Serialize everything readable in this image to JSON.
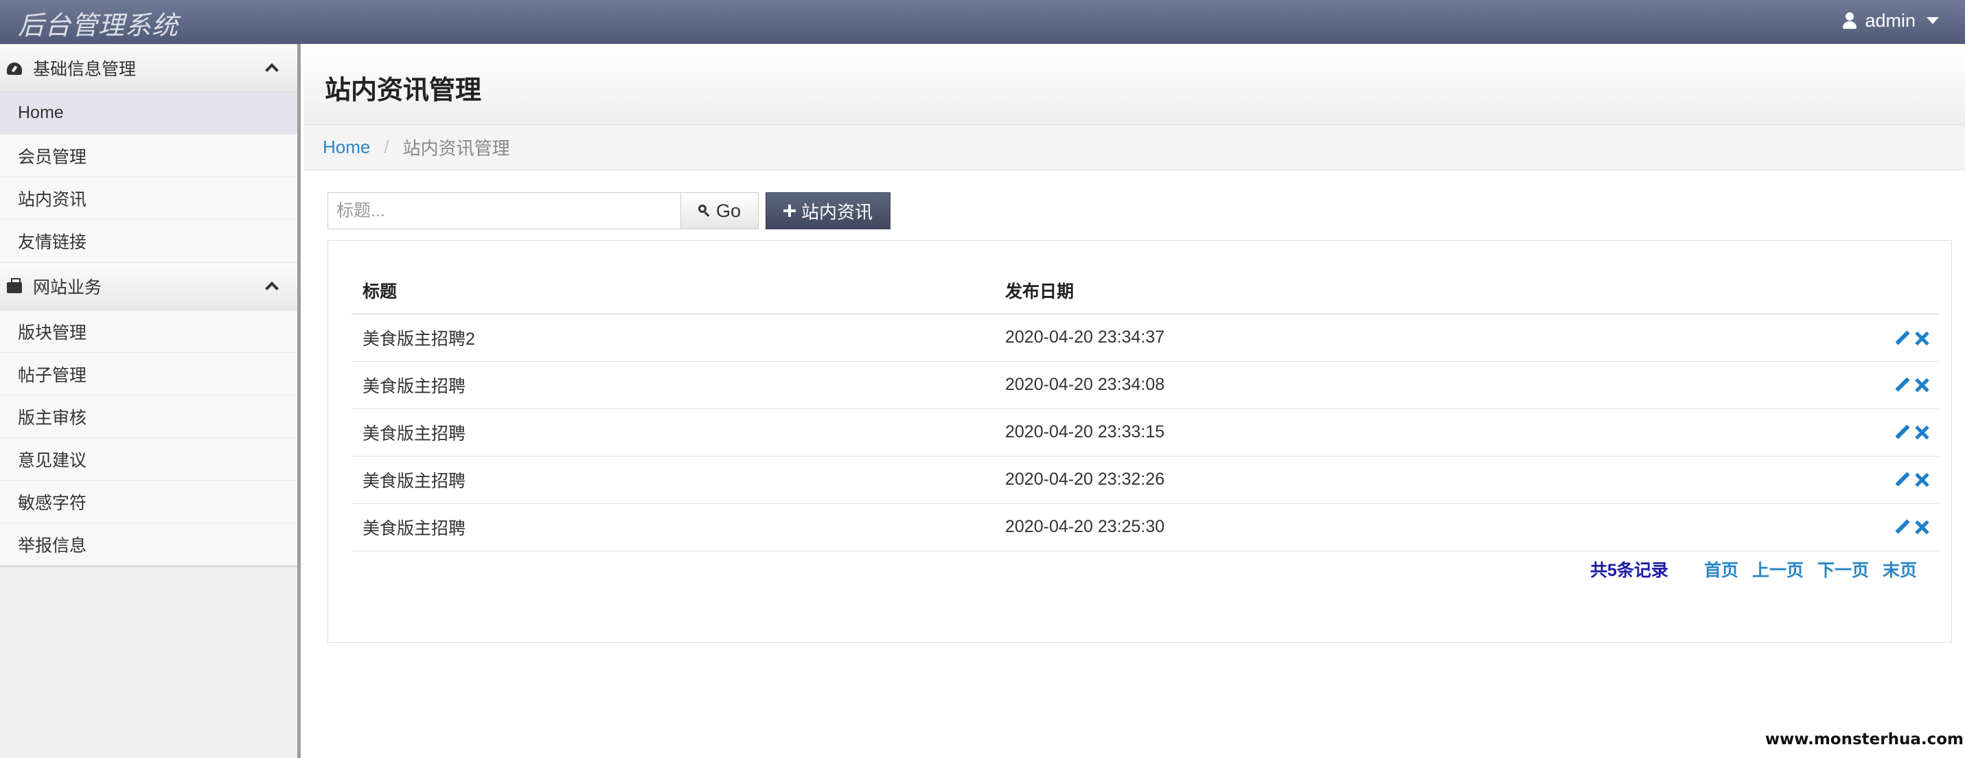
{
  "app": {
    "brand": "后台管理系统",
    "user": "admin"
  },
  "sidebar": {
    "groups": [
      {
        "label": "基础信息管理",
        "icon": "dashboard-icon",
        "items": [
          {
            "label": "Home",
            "active": true
          },
          {
            "label": "会员管理"
          },
          {
            "label": "站内资讯"
          },
          {
            "label": "友情链接"
          }
        ]
      },
      {
        "label": "网站业务",
        "icon": "briefcase-icon",
        "items": [
          {
            "label": "版块管理"
          },
          {
            "label": "帖子管理"
          },
          {
            "label": "版主审核"
          },
          {
            "label": "意见建议"
          },
          {
            "label": "敏感字符"
          },
          {
            "label": "举报信息"
          }
        ]
      }
    ]
  },
  "page": {
    "title": "站内资讯管理",
    "breadcrumb": {
      "home": "Home",
      "current": "站内资讯管理"
    }
  },
  "toolbar": {
    "search_placeholder": "标题...",
    "search_value": "",
    "go_label": "Go",
    "add_label": "站内资讯"
  },
  "table": {
    "headers": {
      "title": "标题",
      "date": "发布日期"
    },
    "rows": [
      {
        "title": "美食版主招聘2",
        "date": "2020-04-20 23:34:37"
      },
      {
        "title": "美食版主招聘",
        "date": "2020-04-20 23:34:08"
      },
      {
        "title": "美食版主招聘",
        "date": "2020-04-20 23:33:15"
      },
      {
        "title": "美食版主招聘",
        "date": "2020-04-20 23:32:26"
      },
      {
        "title": "美食版主招聘",
        "date": "2020-04-20 23:25:30"
      }
    ]
  },
  "pagination": {
    "total": "共5条记录",
    "first": "首页",
    "prev": "上一页",
    "next": "下一页",
    "last": "末页"
  },
  "watermark": "www.monsterhua.com",
  "colors": {
    "topbar": "#5a6584",
    "link": "#2a86c4",
    "accent_button": "#4a536b",
    "total_text": "#1a1aa6"
  }
}
